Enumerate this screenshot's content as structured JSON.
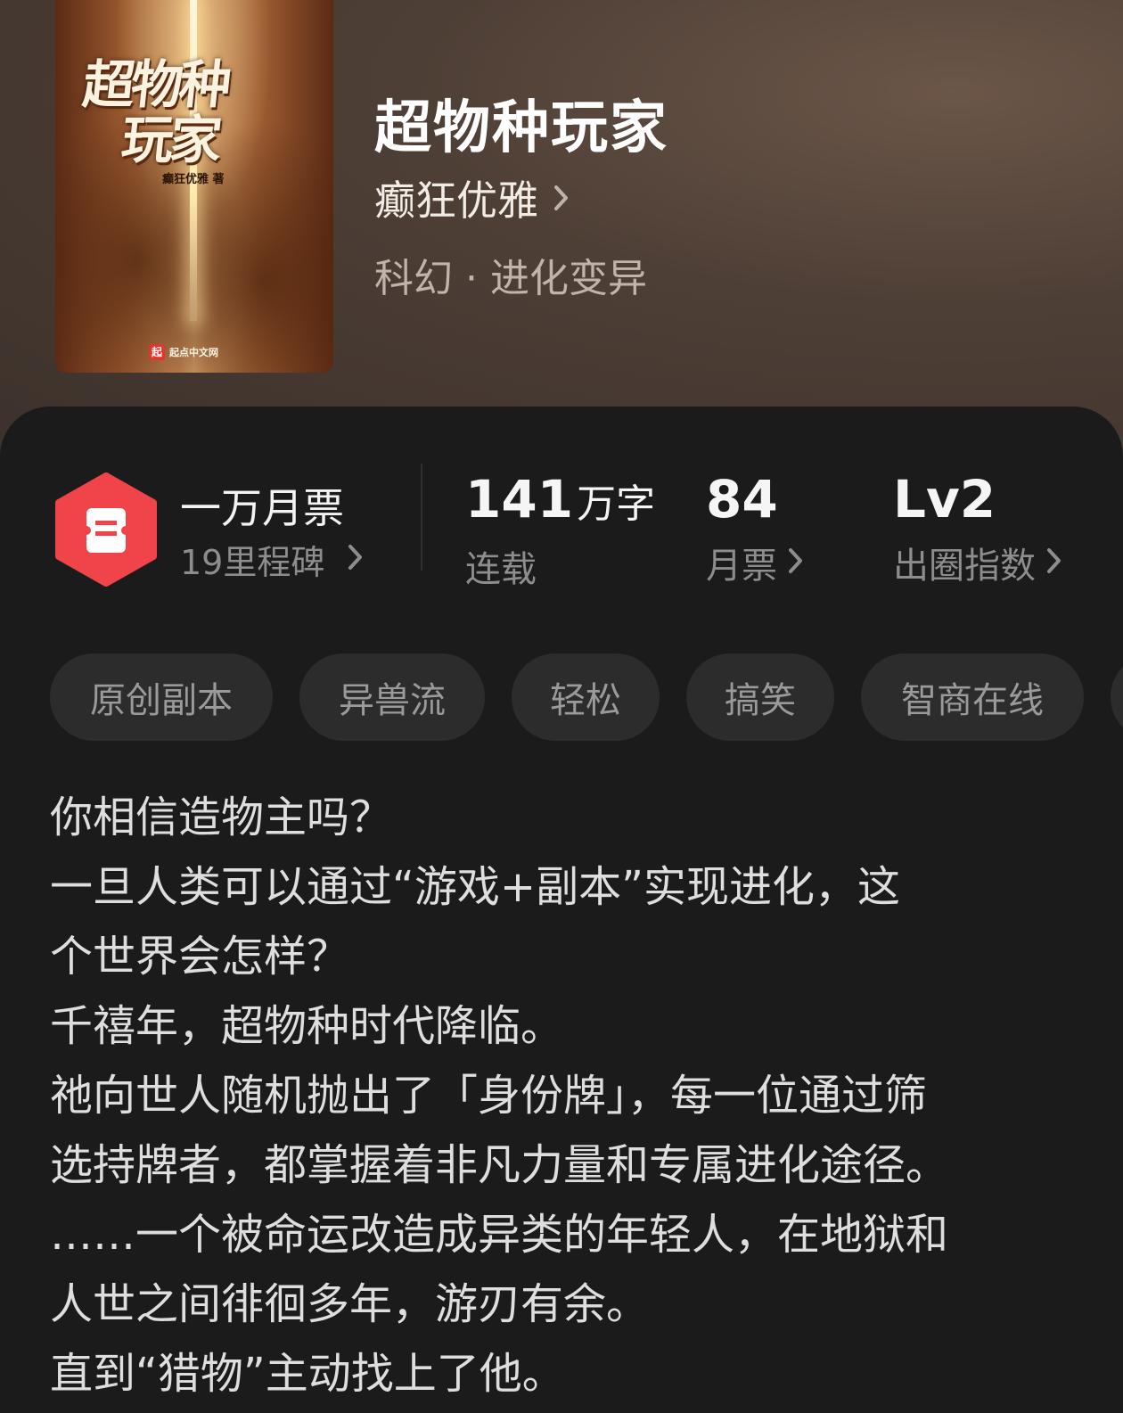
{
  "book": {
    "title": "超物种玩家",
    "author": "癫狂优雅",
    "category": "科幻 · 进化变异",
    "cover": {
      "title_line1": "超物种",
      "title_line2": "玩家",
      "author": "癫狂优雅 著",
      "publisher_logo": "起",
      "publisher": "起点中文网"
    }
  },
  "stats": {
    "monthly_ticket_milestone": {
      "title": "一万月票",
      "subtitle": "19里程碑",
      "icon": "ticket-icon",
      "icon_color": "#f0434a"
    },
    "word_count": {
      "value": "141",
      "unit": "万字",
      "label": "连载"
    },
    "monthly_tickets": {
      "value": "84",
      "label": "月票"
    },
    "influence": {
      "value": "Lv2",
      "label": "出圈指数"
    }
  },
  "tags": [
    "原创副本",
    "异兽流",
    "轻松",
    "搞笑",
    "智商在线"
  ],
  "synopsis": [
    "你相信造物主吗？",
    "一旦人类可以通过“游戏+副本”实现进化，这",
    "个世界会怎样？",
    "千禧年，超物种时代降临。",
    "祂向世人随机抛出了「身份牌」，每一位通过筛",
    "选持牌者，都掌握着非凡力量和专属进化途径。",
    "……一个被命运改造成异类的年轻人，在地狱和",
    "人世之间徘徊多年，游刃有余。",
    "直到“猎物”主动找上了他。"
  ]
}
